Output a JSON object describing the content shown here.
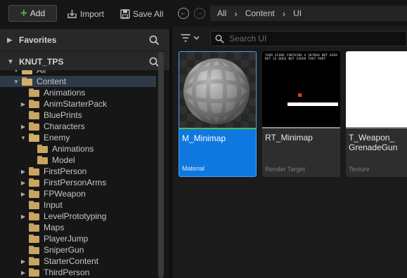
{
  "toolbar": {
    "add_label": "Add",
    "import_label": "Import",
    "save_all_label": "Save All"
  },
  "breadcrumb": [
    "All",
    "Content",
    "UI"
  ],
  "sources": {
    "favorites_label": "Favorites",
    "project_label": "KNUT_TPS",
    "tree": [
      {
        "label": "All",
        "depth": 1,
        "open": true,
        "partial": true
      },
      {
        "label": "Content",
        "depth": 1,
        "open": true,
        "selected": true
      },
      {
        "label": "Animations",
        "depth": 2,
        "expandable": false
      },
      {
        "label": "AnimStarterPack",
        "depth": 2,
        "expandable": true
      },
      {
        "label": "BluePrints",
        "depth": 2,
        "expandable": false
      },
      {
        "label": "Characters",
        "depth": 2,
        "expandable": true
      },
      {
        "label": "Enemy",
        "depth": 2,
        "expandable": true,
        "open": true
      },
      {
        "label": "Animations",
        "depth": 3,
        "expandable": false
      },
      {
        "label": "Model",
        "depth": 3,
        "expandable": false
      },
      {
        "label": "FirstPerson",
        "depth": 2,
        "expandable": true
      },
      {
        "label": "FirstPersonArms",
        "depth": 2,
        "expandable": true
      },
      {
        "label": "FPWeapon",
        "depth": 2,
        "expandable": true
      },
      {
        "label": "Input",
        "depth": 2,
        "expandable": false
      },
      {
        "label": "LevelPrototyping",
        "depth": 2,
        "expandable": true
      },
      {
        "label": "Maps",
        "depth": 2,
        "expandable": false
      },
      {
        "label": "PlayerJump",
        "depth": 2,
        "expandable": false
      },
      {
        "label": "SniperGun",
        "depth": 2,
        "expandable": false
      },
      {
        "label": "StarterContent",
        "depth": 2,
        "expandable": true
      },
      {
        "label": "ThirdPerson",
        "depth": 2,
        "expandable": true
      }
    ]
  },
  "search": {
    "placeholder": "Search UI"
  },
  "assets": [
    {
      "name": "M_Minimap",
      "type": "Material",
      "selected": true,
      "accent": "#4fc040",
      "thumb": "material-sphere"
    },
    {
      "name": "RT_Minimap",
      "type": "Render Target",
      "selected": false,
      "accent": "#8a8a8a",
      "thumb": "render-target",
      "preview_text": "YOUR SCENE CONTAINS A SKYBOX NOT USED BUT IS DOES NOT COVER THAT PART"
    },
    {
      "name": "T_Weapon_ GrenadeGun",
      "type": "Texture",
      "selected": false,
      "accent": "#8a8a8a",
      "thumb": "white-texture"
    }
  ],
  "colors": {
    "accent_blue": "#0f78e0",
    "add_green": "#4fb43f",
    "folder": "#c9a463"
  }
}
